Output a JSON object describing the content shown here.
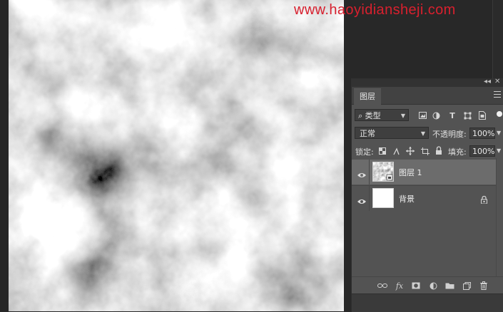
{
  "watermark": "www.haoyidiansheji.com",
  "panel": {
    "tab_label": "图层",
    "collapse_glyph": "◂◂",
    "close_glyph": "✕"
  },
  "filter": {
    "kind_label": "类型",
    "search_glyph": "⌕"
  },
  "blend": {
    "mode": "正常",
    "opacity_label": "不透明度:",
    "opacity_value": "100%"
  },
  "lock": {
    "label": "锁定:",
    "fill_label": "填充:",
    "fill_value": "100%"
  },
  "layers": [
    {
      "name": "图层 1",
      "selected": true,
      "thumbnail": "clouds-texture"
    },
    {
      "name": "背景",
      "selected": false,
      "thumbnail": "white",
      "locked": true
    }
  ],
  "footer_icons": [
    "link-layers-icon",
    "fx-icon",
    "mask-icon",
    "adjustment-icon",
    "group-folder-icon",
    "new-layer-icon",
    "trash-icon"
  ],
  "footer_fx": "fx",
  "colors": {
    "panel_bg": "#535353",
    "selected_row": "#6c6c6c",
    "watermark_red": "#d8202e"
  }
}
